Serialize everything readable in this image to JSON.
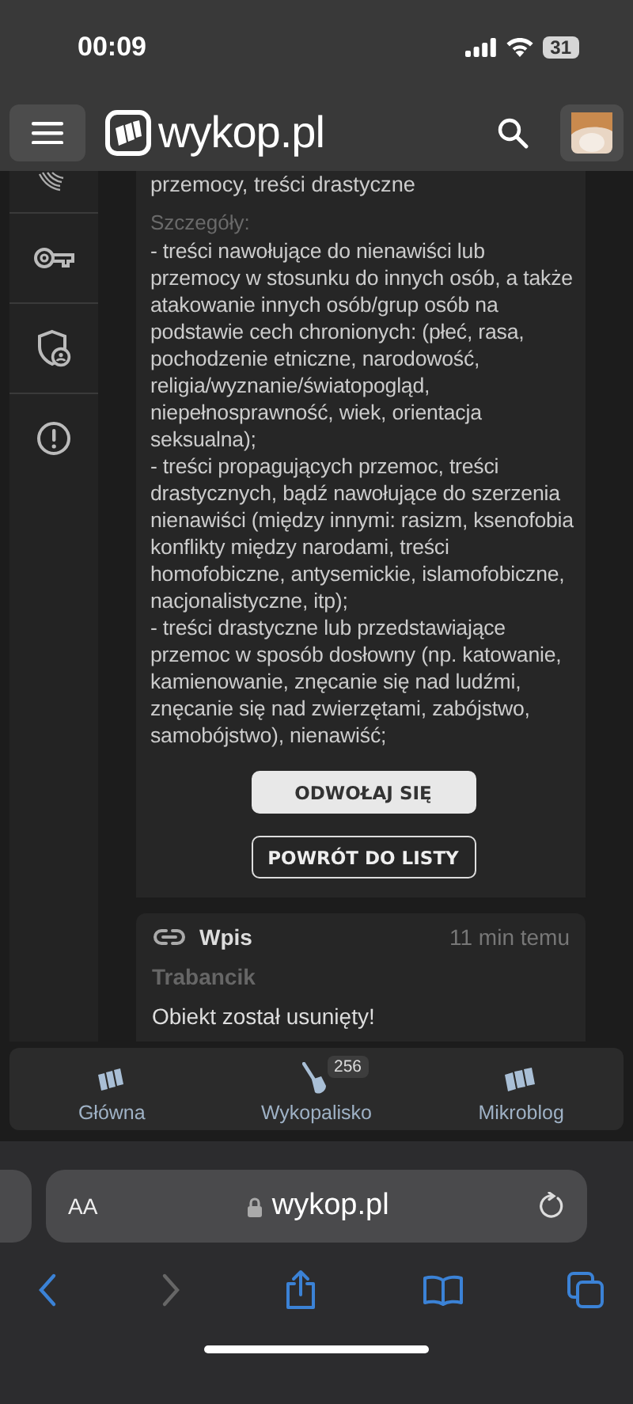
{
  "status_bar": {
    "time": "00:09",
    "battery": "31"
  },
  "header": {
    "logo_text": "wykop.pl"
  },
  "sidebar": {
    "items": [
      {
        "kind": "fingerprint"
      },
      {
        "kind": "key"
      },
      {
        "kind": "shield"
      },
      {
        "kind": "alert"
      }
    ]
  },
  "report": {
    "reason": "przemocy, treści drastyczne",
    "details_label": "Szczegóły:",
    "details": [
      "- treści nawołujące do nienawiści lub przemocy w stosunku do innych osób, a także atakowanie innych osób/grup osób na podstawie cech chronionych: (płeć, rasa, pochodzenie etniczne, narodowość, religia/wyznanie/światopogląd, niepełnosprawność, wiek, orientacja seksualna);",
      "- treści propagujących przemoc, treści drastycznych, bądź nawołujące do szerzenia nienawiści (między innymi: rasizm, ksenofobia konflikty między narodami, treści homofobiczne, antysemickie, islamofobiczne, nacjonalistyczne, itp);",
      "- treści drastyczne lub przedstawiające przemoc w sposób dosłowny (np. katowanie, kamienowanie, znęcanie się nad ludźmi, znęcanie się nad zwierzętami, zabójstwo, samobójstwo), nienawiść;"
    ],
    "buttons": [
      {
        "label": "ODWOŁAJ SIĘ",
        "kind": "primary"
      },
      {
        "label": "POWRÓT DO LISTY",
        "kind": "outline"
      }
    ]
  },
  "entry": {
    "type": "Wpis",
    "time": "11 min temu",
    "author": "Trabancik",
    "message": "Obiekt został usunięty!"
  },
  "bottom_nav": {
    "items": [
      {
        "label": "Główna",
        "kind": "home"
      },
      {
        "label": "Wykopalisko",
        "kind": "dig",
        "badge": "256"
      },
      {
        "label": "Mikroblog",
        "kind": "micro"
      }
    ]
  },
  "browser": {
    "text_size": "AA",
    "url": "wykop.pl"
  }
}
